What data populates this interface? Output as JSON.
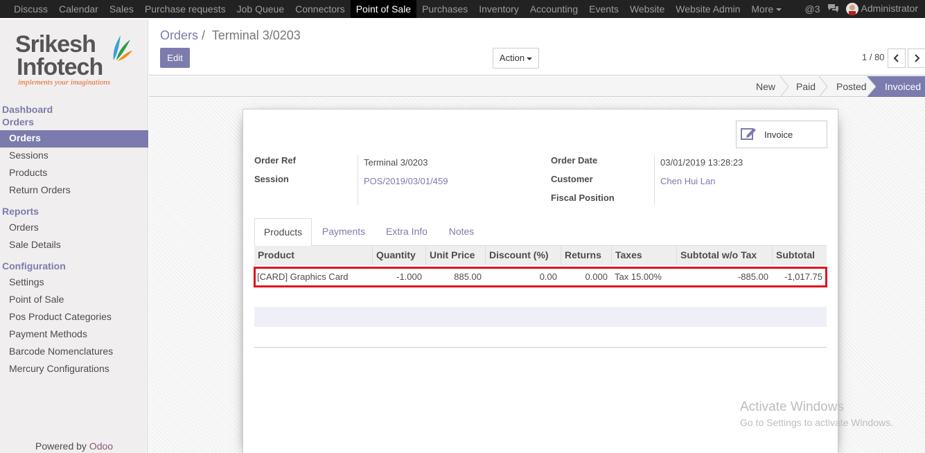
{
  "topbar": {
    "menu": [
      "Discuss",
      "Calendar",
      "Sales",
      "Purchase requests",
      "Job Queue",
      "Connectors",
      "Point of Sale",
      "Purchases",
      "Inventory",
      "Accounting",
      "Events",
      "Website",
      "Website Admin",
      "More"
    ],
    "active_menu": "Point of Sale",
    "mentions": "@3",
    "user": "Administrator"
  },
  "logo": {
    "line1": "Srikesh",
    "line2": "Infotech",
    "tagline": "implements your imaginations"
  },
  "sidebar": {
    "sections": [
      {
        "heading": "Dashboard",
        "items": []
      },
      {
        "heading": "Orders",
        "items": [
          "Orders",
          "Sessions",
          "Products",
          "Return Orders"
        ]
      },
      {
        "heading": "Reports",
        "items": [
          "Orders",
          "Sale Details"
        ]
      },
      {
        "heading": "Configuration",
        "items": [
          "Settings",
          "Point of Sale",
          "Pos Product Categories",
          "Payment Methods",
          "Barcode Nomenclatures",
          "Mercury Configurations"
        ]
      }
    ],
    "active_item": "Orders",
    "powered_by": "Powered by",
    "powered_brand": "Odoo"
  },
  "control_panel": {
    "breadcrumb_parent": "Orders",
    "breadcrumb_separator": "/",
    "breadcrumb_current": "Terminal 3/0203",
    "edit_label": "Edit",
    "action_label": "Action",
    "pager": "1 / 80"
  },
  "statusbar": {
    "stages": [
      "New",
      "Paid",
      "Posted",
      "Invoiced"
    ],
    "current": "Invoiced"
  },
  "form": {
    "invoice_button": "Invoice",
    "order_ref_label": "Order Ref",
    "order_ref": "Terminal 3/0203",
    "session_label": "Session",
    "session": "POS/2019/03/01/459",
    "order_date_label": "Order Date",
    "order_date": "03/01/2019 13:28:23",
    "customer_label": "Customer",
    "customer": "Chen Hui Lan",
    "fiscal_position_label": "Fiscal Position",
    "fiscal_position": ""
  },
  "tabs": [
    "Products",
    "Payments",
    "Extra Info",
    "Notes"
  ],
  "active_tab": "Products",
  "lines_table": {
    "columns": [
      "Product",
      "Quantity",
      "Unit Price",
      "Discount (%)",
      "Returns",
      "Taxes",
      "Subtotal w/o Tax",
      "Subtotal"
    ],
    "rows": [
      [
        "[CARD] Graphics Card",
        "-1.000",
        "885.00",
        "0.00",
        "0.000",
        "Tax 15.00%",
        "-885.00",
        "-1,017.75"
      ]
    ]
  },
  "watermark": {
    "line1": "Activate Windows",
    "line2": "Go to Settings to activate Windows."
  },
  "colors": {
    "accent": "#7c7bad",
    "highlight": "#e0141e",
    "navbar": "#222222"
  }
}
